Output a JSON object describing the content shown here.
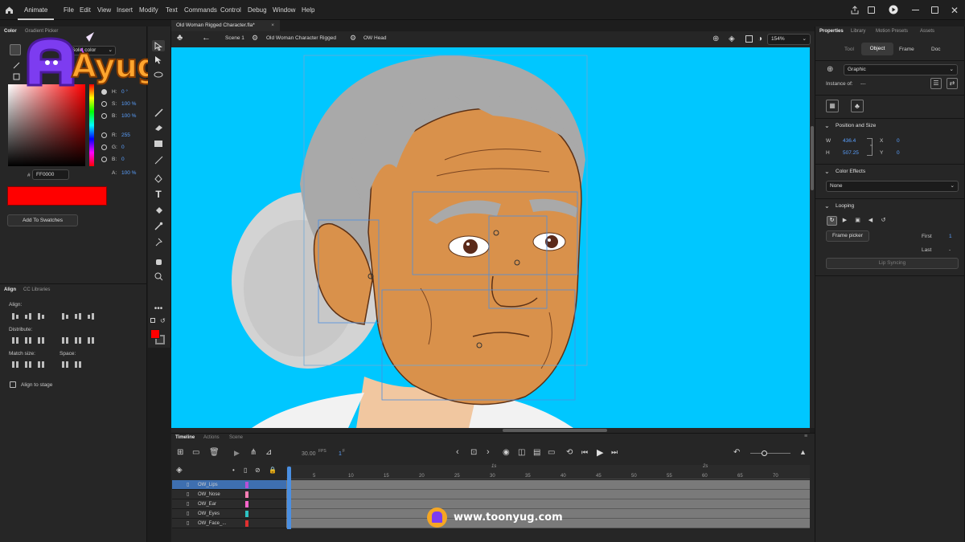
{
  "menubar": {
    "app": "Animate",
    "items": [
      "File",
      "Edit",
      "View",
      "Insert",
      "Modify",
      "Text",
      "Commands",
      "Control",
      "Debug",
      "Window",
      "Help"
    ]
  },
  "left_panel": {
    "tabs": [
      "Color",
      "Gradient Picker"
    ],
    "mode": "Solid color",
    "hsb": [
      {
        "k": "H:",
        "v": "0 °"
      },
      {
        "k": "S:",
        "v": "100 %"
      },
      {
        "k": "B:",
        "v": "100 %"
      }
    ],
    "rgb": [
      {
        "k": "R:",
        "v": "255"
      },
      {
        "k": "G:",
        "v": "0"
      },
      {
        "k": "B:",
        "v": "0"
      }
    ],
    "alpha": {
      "k": "A:",
      "v": "100 %"
    },
    "hex_label": "#",
    "hex": "FF0000",
    "current_color": "#ff0000",
    "add_swatch": "Add To Swatches"
  },
  "align_panel": {
    "tabs": [
      "Align",
      "CC Libraries"
    ],
    "align": "Align:",
    "distribute": "Distribute:",
    "match_size": "Match size:",
    "space": "Space:",
    "to_stage": "Align to stage"
  },
  "document": {
    "tab": "Old Woman Rigged Character.fla*",
    "breadcrumbs": [
      "Scene 1",
      "Old Woman Character Rigged",
      "OW Head"
    ],
    "zoom": "154%"
  },
  "properties": {
    "tabs": [
      "Properties",
      "Library",
      "Motion Presets",
      "Assets"
    ],
    "subtabs": [
      "Tool",
      "Object",
      "Frame",
      "Doc"
    ],
    "symbol_type": "Graphic",
    "instance_of_label": "Instance of:",
    "instance_of_value": "---",
    "pos_size_title": "Position and Size",
    "w_label": "W",
    "w": "436.4",
    "x_label": "X",
    "x": "0",
    "h_label": "H",
    "h": "507.25",
    "y_label": "Y",
    "y": "0",
    "color_effects_title": "Color Effects",
    "color_effect": "None",
    "looping_title": "Looping",
    "frame_picker": "Frame picker",
    "first_label": "First",
    "first": "1",
    "last_label": "Last",
    "last": "-",
    "lip_sync": "Lip Syncing"
  },
  "timeline": {
    "tabs": [
      "Timeline",
      "Actions",
      "Scene"
    ],
    "fps": "30.00",
    "fps_unit": "FPS",
    "frame": "1",
    "frame_unit": "F",
    "seconds_marks": [
      "1s",
      "2s"
    ],
    "frame_numbers": [
      "5",
      "10",
      "15",
      "20",
      "25",
      "30",
      "35",
      "40",
      "45",
      "50",
      "55",
      "60",
      "65",
      "70"
    ],
    "layers": [
      {
        "name": "OW_Lips",
        "color": "#b84fd6",
        "selected": true
      },
      {
        "name": "OW_Nose",
        "color": "#ff7fb5",
        "selected": false
      },
      {
        "name": "OW_Ear",
        "color": "#ff66cc",
        "selected": false
      },
      {
        "name": "OW_Eyes",
        "color": "#2ec4c4",
        "selected": false
      },
      {
        "name": "OW_Face_...",
        "color": "#e03030",
        "selected": false
      }
    ]
  },
  "overlay": {
    "logo": "Ayug",
    "url": "www.toonyug.com",
    "watermark": "Ayug"
  },
  "colors": {
    "stage": "#00c7ff",
    "skin": "#d9914b",
    "hair": "#a9a9a9",
    "accent": "#4a8fe2"
  }
}
